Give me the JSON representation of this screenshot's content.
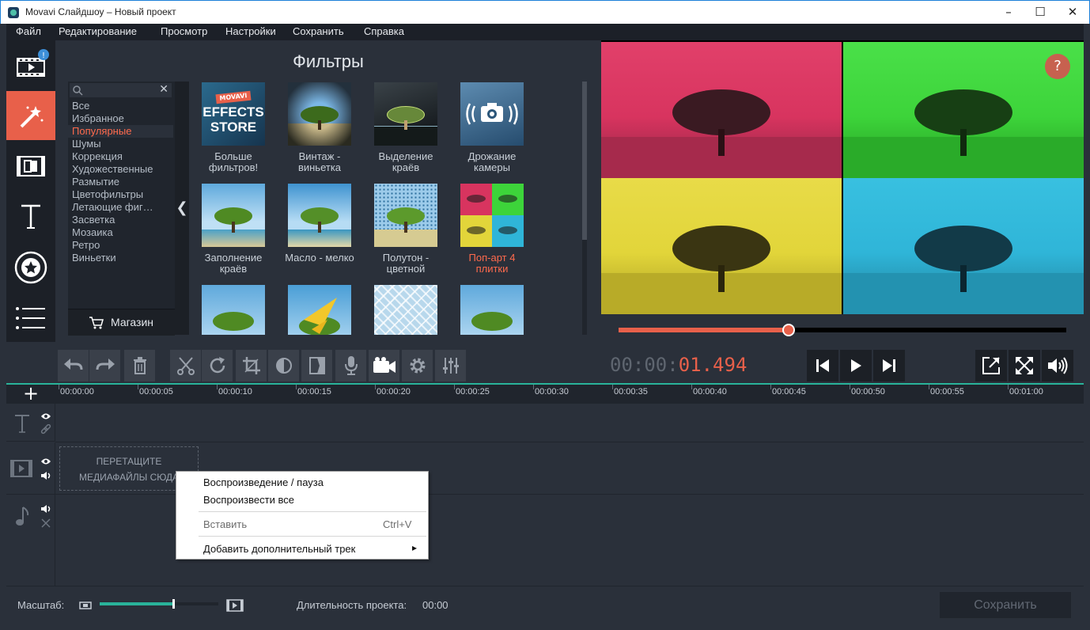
{
  "window": {
    "title": "Movavi Слайдшоу – Новый проект"
  },
  "menu": [
    "Файл",
    "Редактирование",
    "Просмотр",
    "Настройки",
    "Сохранить",
    "Справка"
  ],
  "sidebar": {
    "badge": "!"
  },
  "filters": {
    "title": "Фильтры",
    "search": {
      "value": "",
      "placeholder": ""
    },
    "categories": [
      "Все",
      "Избранное",
      "Популярные",
      "Шумы",
      "Коррекция",
      "Художественные",
      "Размытие",
      "Цветофильтры",
      "Летающие фиг…",
      "Засветка",
      "Мозаика",
      "Ретро",
      "Виньетки"
    ],
    "selected_category": "Популярные",
    "shop_label": "Магазин",
    "tiles": [
      {
        "label": "Больше фильтров!"
      },
      {
        "label": "Винтаж - виньетка"
      },
      {
        "label": "Выделение краёв"
      },
      {
        "label": "Дрожание камеры"
      },
      {
        "label": "Заполнение краёв"
      },
      {
        "label": "Масло - мелко"
      },
      {
        "label": "Полутон - цветной"
      },
      {
        "label": "Поп-арт 4 плитки"
      },
      {
        "label": ""
      },
      {
        "label": ""
      },
      {
        "label": ""
      },
      {
        "label": ""
      }
    ],
    "store_badge": {
      "brand": "MOVAVI",
      "line1": "EFFECTS",
      "line2": "STORE"
    }
  },
  "preview": {
    "help": "?",
    "progress": 0.38,
    "timecode_dim": "00:00:",
    "timecode_hl": "01.494"
  },
  "timeline": {
    "ticks": [
      "00:00:00",
      "00:00:05",
      "00:00:10",
      "00:00:15",
      "00:00:20",
      "00:00:25",
      "00:00:30",
      "00:00:35",
      "00:00:40",
      "00:00:45",
      "00:00:50",
      "00:00:55",
      "00:01:00"
    ],
    "drop_line1": "ПЕРЕТАЩИТЕ",
    "drop_line2": "МЕДИАФАЙЛЫ СЮДА"
  },
  "context_menu": {
    "play_pause": "Воспроизведение / пауза",
    "play_all": "Воспроизвести все",
    "paste": "Вставить",
    "paste_shortcut": "Ctrl+V",
    "add_track": "Добавить дополнительный трек",
    "submenu_arrow": "▸"
  },
  "status": {
    "scale_label": "Масштаб:",
    "scale_value": 0.62,
    "duration_label": "Длительность проекта:",
    "duration_value": "00:00",
    "save_button": "Сохранить"
  },
  "colors": {
    "accent": "#e8604a",
    "teal": "#29b39a",
    "popart": [
      "#d8345f",
      "#3dd43a",
      "#e2d53a",
      "#2fb5d8"
    ]
  }
}
